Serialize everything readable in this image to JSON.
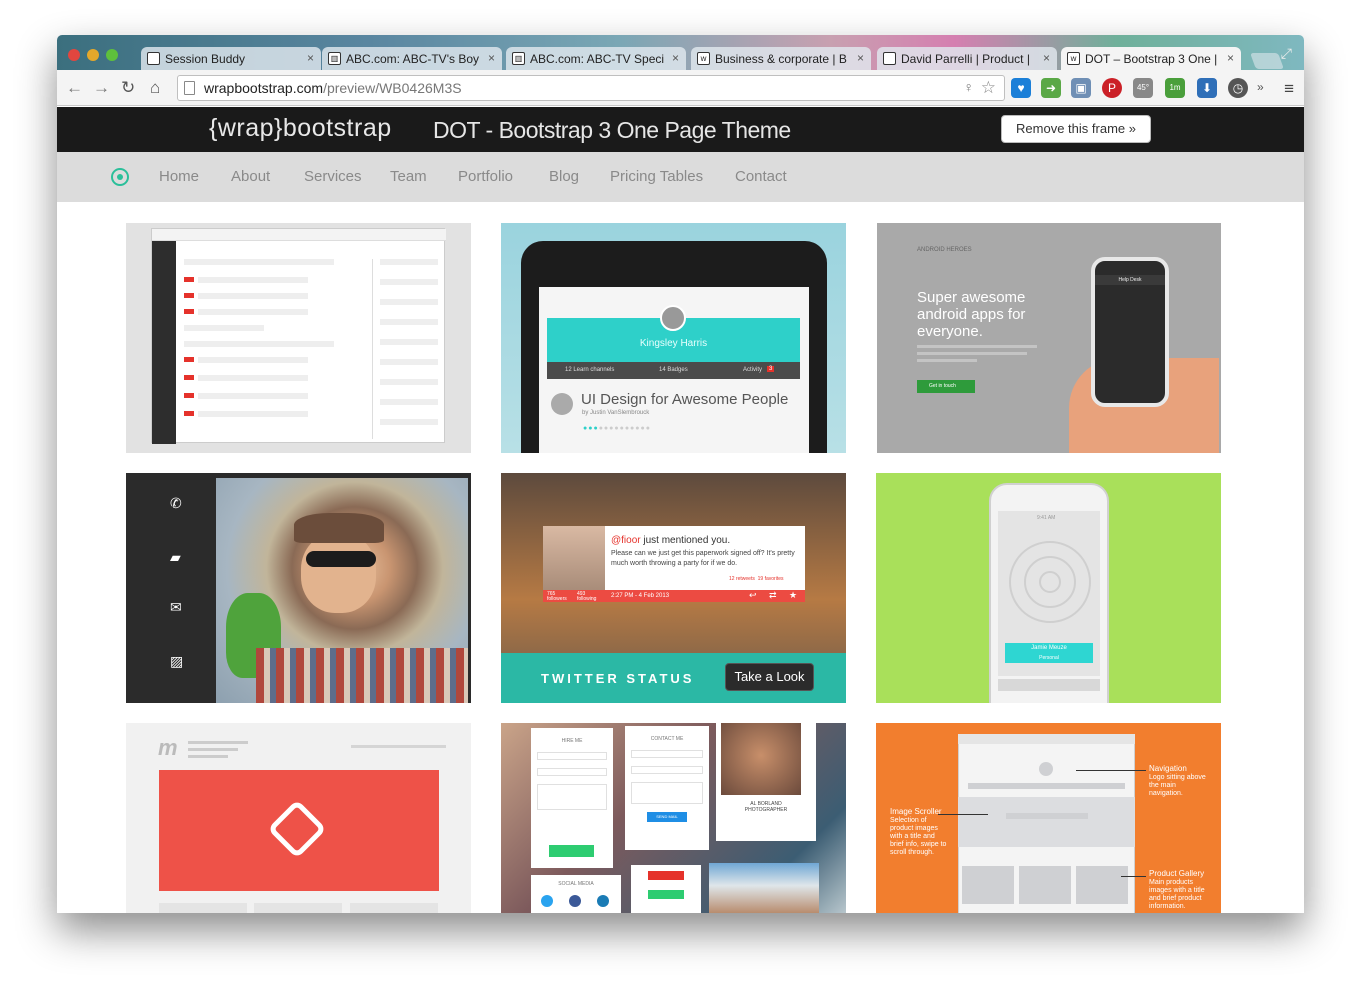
{
  "browser": {
    "tabs": [
      {
        "title": "Session Buddy",
        "active": false
      },
      {
        "title": "ABC.com: ABC-TV's Boy",
        "active": false
      },
      {
        "title": "ABC.com: ABC-TV Speci",
        "active": false
      },
      {
        "title": "Business & corporate | B",
        "active": false
      },
      {
        "title": "David Parrelli | Product |",
        "active": false
      },
      {
        "title": "DOT – Bootstrap 3 One |",
        "active": true
      }
    ],
    "url_domain": "wrapbootstrap.com",
    "url_path": "/preview/WB0426M3S",
    "extension_badges": {
      "weather": "45°",
      "timer": "1m"
    }
  },
  "wrapbar": {
    "logo": "{wrap}bootstrap",
    "title": "DOT - Bootstrap 3 One Page Theme",
    "remove_button": "Remove this frame »"
  },
  "nav": {
    "items": [
      "Home",
      "About",
      "Services",
      "Team",
      "Portfolio",
      "Blog",
      "Pricing Tables",
      "Contact"
    ]
  },
  "portfolio": {
    "tile2": {
      "name": "Kingsley Harris",
      "tab1": "12 Learn channels",
      "tab2": "14 Badges",
      "tab3": "Activity",
      "activity_count": "3",
      "title": "UI Design for Awesome People",
      "byline": "by Justin VanSlembrouck"
    },
    "tile3": {
      "logo": "ANDROID HEROES",
      "headline": "Super awesome android apps for everyone.",
      "button": "Get in touch",
      "phone_header": "Help Desk"
    },
    "tile5": {
      "handle": "@fioor",
      "mention": "just mentioned you.",
      "message": "Please can we just get this paperwork signed off? It's pretty much worth throwing a party for if we do.",
      "retweets": "12 retweets",
      "favorites": "19 favorites",
      "followers": "765 followers",
      "following": "493 following",
      "timestamp": "2:27 PM - 4 Feb 2013",
      "label": "TWITTER STATUS",
      "button": "Take a Look"
    },
    "tile6": {
      "time": "9:41 AM",
      "name": "Jamie Meuze",
      "subtitle": "Personal"
    },
    "tile8": {
      "hire_me": "HIRE ME",
      "contact_me": "CONTACT ME",
      "name": "AL BORLAND",
      "role": "PHOTOGRAPHER",
      "social": "SOCIAL MEDIA",
      "send": "SEND MAIL"
    },
    "tile9": {
      "nav_title": "Navigation",
      "nav_desc": "Logo sitting above the main navigation.",
      "scroller_title": "Image Scroller",
      "scroller_desc": "Selection of product images with a title and brief info, swipe to scroll through.",
      "gallery_title": "Product Gallery",
      "gallery_desc": "Main products images with a title and brief product information."
    }
  },
  "colors": {
    "accent": "#2bbf9a",
    "wrapbar": "#1a1a1a",
    "navbar": "#dcdcdc"
  }
}
